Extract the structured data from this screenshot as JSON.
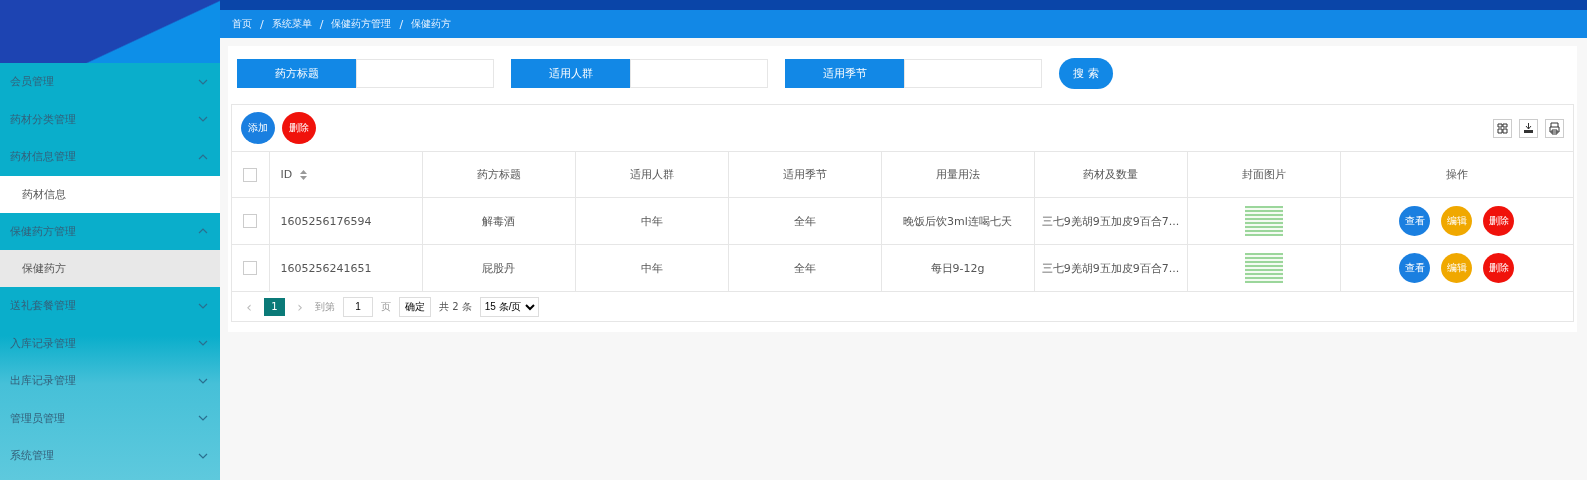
{
  "breadcrumb": {
    "items": [
      "首页",
      "系统菜单",
      "保健药方管理",
      "保健药方"
    ],
    "separators": [
      "/",
      "/",
      "/"
    ]
  },
  "sidebar": {
    "items": [
      {
        "label": "会员管理",
        "expanded": false
      },
      {
        "label": "药材分类管理",
        "expanded": false
      },
      {
        "label": "药材信息管理",
        "expanded": true,
        "children": [
          {
            "label": "药材信息",
            "selected": false
          }
        ]
      },
      {
        "label": "保健药方管理",
        "expanded": true,
        "children": [
          {
            "label": "保健药方",
            "selected": true
          }
        ]
      },
      {
        "label": "送礼套餐管理",
        "expanded": false
      },
      {
        "label": "入库记录管理",
        "expanded": false
      },
      {
        "label": "出库记录管理",
        "expanded": false
      },
      {
        "label": "管理员管理",
        "expanded": false
      },
      {
        "label": "系统管理",
        "expanded": false
      }
    ]
  },
  "search": {
    "fields": [
      {
        "label": "药方标题"
      },
      {
        "label": "适用人群"
      },
      {
        "label": "适用季节"
      }
    ],
    "button": "搜 索"
  },
  "toolbar": {
    "buttons": [
      {
        "label": "添加",
        "kind": "add"
      },
      {
        "label": "删除",
        "kind": "delete"
      }
    ]
  },
  "table": {
    "select_all_checked": false,
    "columns": [
      "ID",
      "药方标题",
      "适用人群",
      "适用季节",
      "用量用法",
      "药材及数量",
      "封面图片",
      "操作"
    ],
    "rows": [
      {
        "checked": false,
        "cells": [
          "1605256176594",
          "解毒酒",
          "中年",
          "全年",
          "晚饭后饮3ml连喝七天",
          "三七9羌胡9五加皮9百合7..."
        ],
        "actions": [
          {
            "label": "查看",
            "kind": "view"
          },
          {
            "label": "编辑",
            "kind": "edit"
          },
          {
            "label": "删除",
            "kind": "delete"
          }
        ]
      },
      {
        "checked": false,
        "cells": [
          "1605256241651",
          "屁股丹",
          "中年",
          "全年",
          "每日9-12g",
          "三七9羌胡9五加皮9百合7..."
        ],
        "actions": [
          {
            "label": "查看",
            "kind": "view"
          },
          {
            "label": "编辑",
            "kind": "edit"
          },
          {
            "label": "删除",
            "kind": "delete"
          }
        ]
      }
    ]
  },
  "pagination": {
    "prev": "‹",
    "current": "1",
    "next": "›",
    "goto_label": "到第",
    "page_input": "1",
    "page_unit": "页",
    "confirm": "确定",
    "total": "共 2 条",
    "page_size": "15 条/页"
  }
}
